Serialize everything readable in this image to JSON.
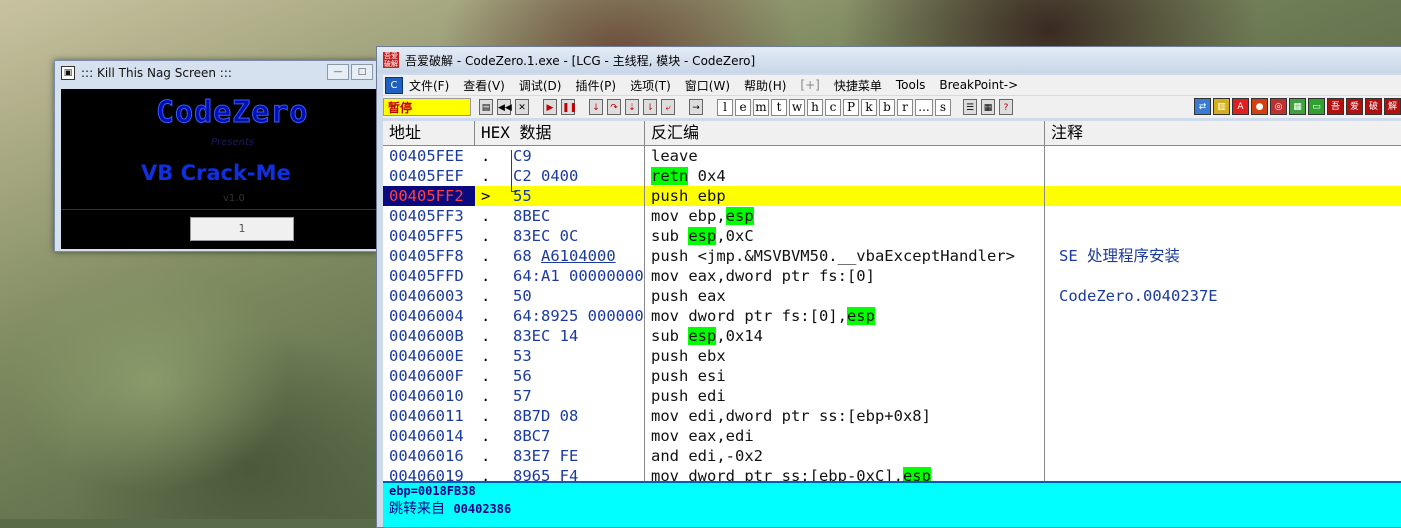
{
  "nag": {
    "title": "::: Kill This Nag Screen :::",
    "logo": "CodeZero",
    "presents": "Presents",
    "heading": "VB Crack-Me",
    "version": "v1.0",
    "button": "1"
  },
  "olly": {
    "title": "吾爱破解 - CodeZero.1.exe - [LCG - 主线程, 模块 - CodeZero]",
    "menu": [
      "文件(F)",
      "查看(V)",
      "调试(D)",
      "插件(P)",
      "选项(T)",
      "窗口(W)",
      "帮助(H)",
      "[+]",
      "快捷菜单",
      "Tools",
      "BreakPoint->"
    ],
    "status": "暂停",
    "letter_buttons": [
      "l",
      "e",
      "m",
      "t",
      "w",
      "h",
      "c",
      "P",
      "k",
      "b",
      "r",
      "...",
      "s"
    ],
    "columns": {
      "address": "地址",
      "hex": "HEX 数据",
      "disasm": "反汇编",
      "comment": "注释"
    },
    "rows": [
      {
        "addr": "00405FEE",
        "mark": ".",
        "hex": "C9",
        "dis": "leave",
        "cmt": ""
      },
      {
        "addr": "00405FEF",
        "mark": ".",
        "hex": "C2 0400",
        "dis": "retn 0x4",
        "cmt": ""
      },
      {
        "addr": "00405FF2",
        "mark": ">",
        "hex": "55",
        "dis": "push ebp",
        "cmt": ""
      },
      {
        "addr": "00405FF3",
        "mark": ".",
        "hex": "8BEC",
        "dis": "mov ebp,esp",
        "cmt": ""
      },
      {
        "addr": "00405FF5",
        "mark": ".",
        "hex": "83EC 0C",
        "dis": "sub esp,0xC",
        "cmt": ""
      },
      {
        "addr": "00405FF8",
        "mark": ".",
        "hex": "68 A6104000",
        "dis": "push <jmp.&MSVBVM50.__vbaExceptHandler>",
        "cmt": "SE 处理程序安装"
      },
      {
        "addr": "00405FFD",
        "mark": ".",
        "hex": "64:A1 00000000",
        "dis": "mov eax,dword ptr fs:[0]",
        "cmt": ""
      },
      {
        "addr": "00406003",
        "mark": ".",
        "hex": "50",
        "dis": "push eax",
        "cmt": "CodeZero.0040237E"
      },
      {
        "addr": "00406004",
        "mark": ".",
        "hex": "64:8925 00000000",
        "dis": "mov dword ptr fs:[0],esp",
        "cmt": ""
      },
      {
        "addr": "0040600B",
        "mark": ".",
        "hex": "83EC 14",
        "dis": "sub esp,0x14",
        "cmt": ""
      },
      {
        "addr": "0040600E",
        "mark": ".",
        "hex": "53",
        "dis": "push ebx",
        "cmt": ""
      },
      {
        "addr": "0040600F",
        "mark": ".",
        "hex": "56",
        "dis": "push esi",
        "cmt": ""
      },
      {
        "addr": "00406010",
        "mark": ".",
        "hex": "57",
        "dis": "push edi",
        "cmt": ""
      },
      {
        "addr": "00406011",
        "mark": ".",
        "hex": "8B7D 08",
        "dis": "mov edi,dword ptr ss:[ebp+0x8]",
        "cmt": ""
      },
      {
        "addr": "00406014",
        "mark": ".",
        "hex": "8BC7",
        "dis": "mov eax,edi",
        "cmt": ""
      },
      {
        "addr": "00406016",
        "mark": ".",
        "hex": "83E7 FE",
        "dis": "and edi,-0x2",
        "cmt": ""
      },
      {
        "addr": "00406019",
        "mark": ".",
        "hex": "8965 F4",
        "dis": "mov dword ptr ss:[ebp-0xC],esp",
        "cmt": ""
      }
    ],
    "info_line1": "ebp=0018FB38",
    "info_label": "跳转来自",
    "info_value": "00402386"
  }
}
